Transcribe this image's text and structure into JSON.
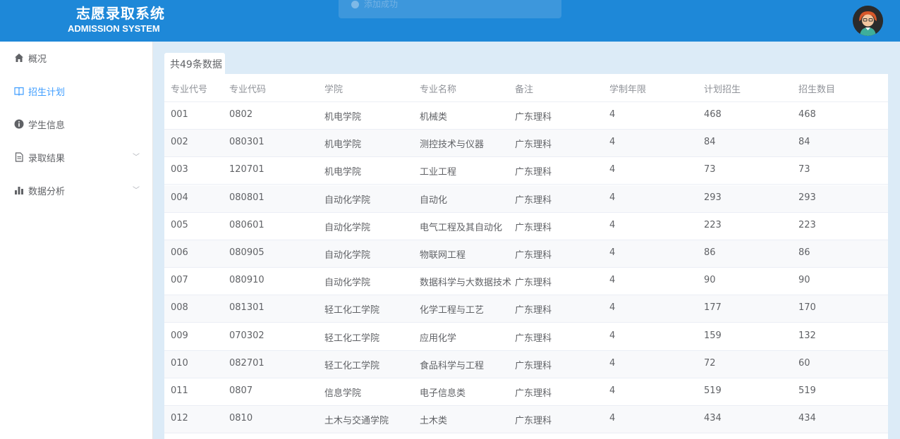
{
  "header": {
    "title_cn": "志愿录取系统",
    "title_en": "ADMISSION SYSTEM",
    "toast_text": "添加成功"
  },
  "sidebar": {
    "items": [
      {
        "label": "概况",
        "icon": "home-icon"
      },
      {
        "label": "招生计划",
        "icon": "book-icon",
        "active": true
      },
      {
        "label": "学生信息",
        "icon": "info-icon"
      },
      {
        "label": "录取结果",
        "icon": "document-icon",
        "has_submenu": true
      },
      {
        "label": "数据分析",
        "icon": "bar-chart-icon",
        "has_submenu": true
      }
    ]
  },
  "main": {
    "count_label": "共49条数据",
    "columns": [
      "专业代号",
      "专业代码",
      "学院",
      "专业名称",
      "备注",
      "学制年限",
      "计划招生",
      "招生数目"
    ],
    "rows": [
      [
        "001",
        "0802",
        "机电学院",
        "机械类",
        "广东理科",
        "4",
        "468",
        "468"
      ],
      [
        "002",
        "080301",
        "机电学院",
        "测控技术与仪器",
        "广东理科",
        "4",
        "84",
        "84"
      ],
      [
        "003",
        "120701",
        "机电学院",
        "工业工程",
        "广东理科",
        "4",
        "73",
        "73"
      ],
      [
        "004",
        "080801",
        "自动化学院",
        "自动化",
        "广东理科",
        "4",
        "293",
        "293"
      ],
      [
        "005",
        "080601",
        "自动化学院",
        "电气工程及其自动化",
        "广东理科",
        "4",
        "223",
        "223"
      ],
      [
        "006",
        "080905",
        "自动化学院",
        "物联网工程",
        "广东理科",
        "4",
        "86",
        "86"
      ],
      [
        "007",
        "080910",
        "自动化学院",
        "数据科学与大数据技术",
        "广东理科",
        "4",
        "90",
        "90"
      ],
      [
        "008",
        "081301",
        "轻工化工学院",
        "化学工程与工艺",
        "广东理科",
        "4",
        "177",
        "170"
      ],
      [
        "009",
        "070302",
        "轻工化工学院",
        "应用化学",
        "广东理科",
        "4",
        "159",
        "132"
      ],
      [
        "010",
        "082701",
        "轻工化工学院",
        "食品科学与工程",
        "广东理科",
        "4",
        "72",
        "60"
      ],
      [
        "011",
        "0807",
        "信息学院",
        "电子信息类",
        "广东理科",
        "4",
        "519",
        "519"
      ],
      [
        "012",
        "0810",
        "土木与交通学院",
        "土木类",
        "广东理科",
        "4",
        "434",
        "434"
      ]
    ]
  },
  "colors": {
    "header_bg": "#1e88d8",
    "main_bg": "#dcebf7",
    "active": "#409eff"
  }
}
